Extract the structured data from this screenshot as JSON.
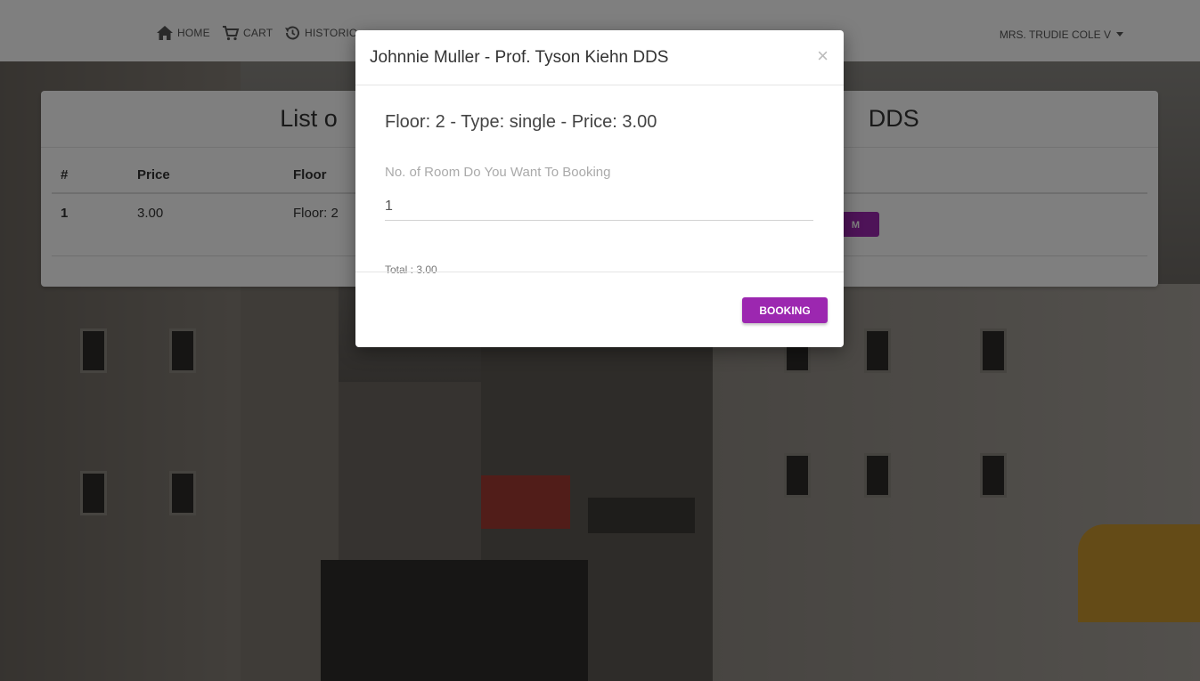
{
  "navbar": {
    "items": [
      {
        "label": "HOME",
        "icon": "home-icon"
      },
      {
        "label": "CART",
        "icon": "cart-icon"
      },
      {
        "label": "HISTORIC",
        "icon": "history-icon"
      }
    ],
    "user": "MRS. TRUDIE COLE V"
  },
  "card": {
    "title_left": "List o",
    "title_right": "DDS",
    "table": {
      "headers": [
        "#",
        "Price",
        "Floor"
      ],
      "rows": [
        {
          "index": "1",
          "price": "3.00",
          "floor": "Floor: 2",
          "action_label": "M"
        }
      ]
    }
  },
  "modal": {
    "title": "Johnnie Muller - Prof. Tyson Kiehn DDS",
    "close_label": "×",
    "room_info": "Floor: 2 - Type: single - Price: 3.00",
    "field_label": "No. of Room Do You Want To Booking",
    "room_count": "1",
    "total": "Total : 3.00",
    "booking_label": "BOOKING"
  },
  "colors": {
    "accent": "#9c27b0",
    "backdrop": "rgba(0,0,0,0.5)"
  }
}
